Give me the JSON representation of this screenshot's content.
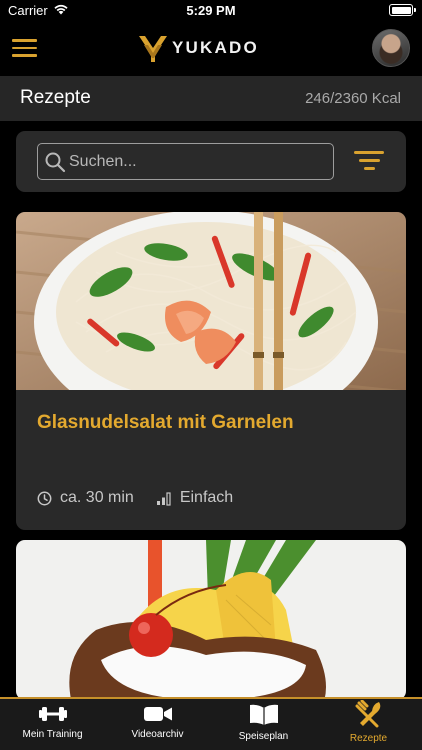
{
  "status_bar": {
    "carrier": "Carrier",
    "time": "5:29 PM"
  },
  "header": {
    "logo_text": "YUKADO",
    "menu_icon": "hamburger-menu-icon",
    "avatar": "user-avatar"
  },
  "section": {
    "title": "Rezepte",
    "kcal": "246/2360 Kcal"
  },
  "search": {
    "placeholder": "Suchen...",
    "value": ""
  },
  "recipes": [
    {
      "title": "Glasnudelsalat mit Garnelen",
      "time": "ca. 30 min",
      "difficulty": "Einfach"
    },
    {
      "title": "",
      "time": "",
      "difficulty": ""
    }
  ],
  "tabs": [
    {
      "label": "Mein Training",
      "icon": "dumbbell-icon",
      "active": false
    },
    {
      "label": "Videoarchiv",
      "icon": "video-camera-icon",
      "active": false
    },
    {
      "label": "Speiseplan",
      "icon": "open-book-icon",
      "active": false
    },
    {
      "label": "Rezepte",
      "icon": "fork-knife-icon",
      "active": true
    }
  ],
  "colors": {
    "accent": "#e3a92f",
    "background": "#000000",
    "card": "#292929",
    "section_bar": "#262626"
  }
}
